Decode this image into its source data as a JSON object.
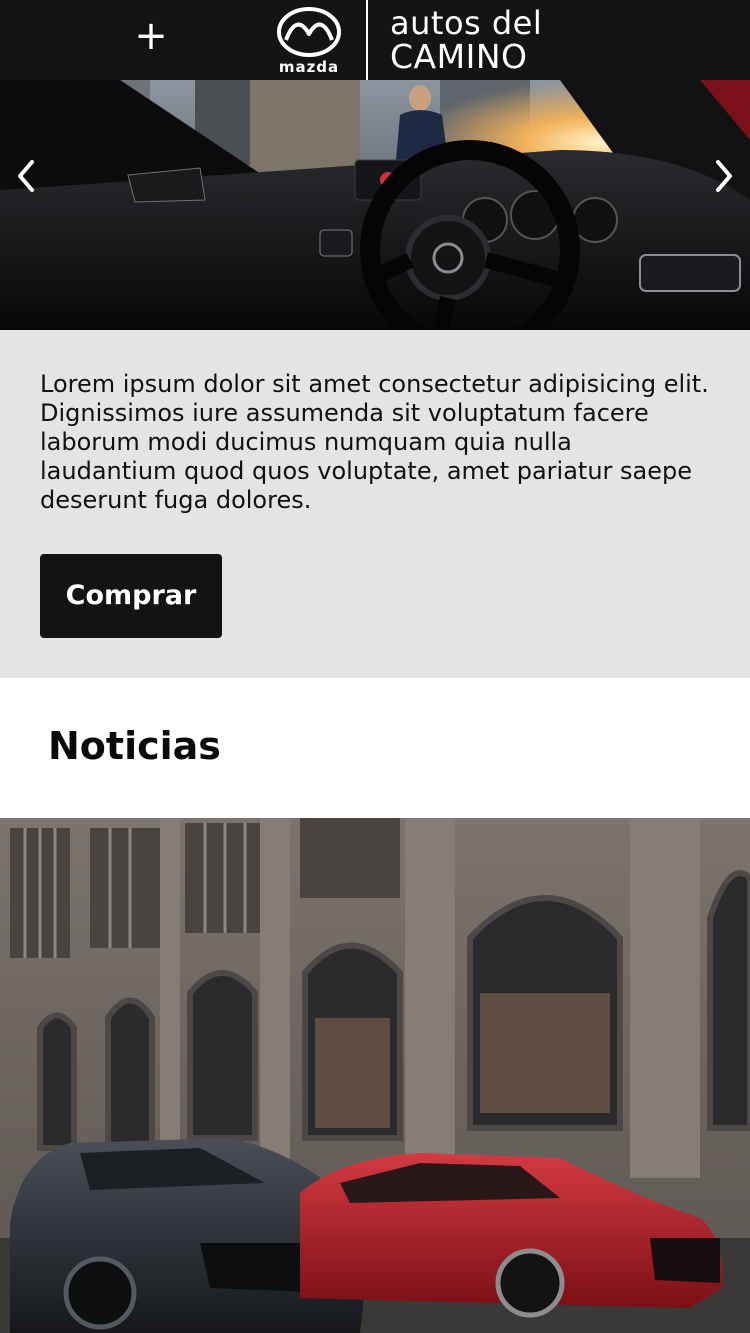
{
  "header": {
    "menu_icon": "plus-icon",
    "mazda_wordmark": "mazda",
    "brand_line1": "autos del",
    "brand_line2": "CAMINO"
  },
  "hero": {
    "image": "car-interior-photo",
    "prev_icon": "chevron-left-icon",
    "next_icon": "chevron-right-icon"
  },
  "promo": {
    "text": "Lorem ipsum dolor sit amet consectetur adipisicing elit. Dignissimos iure assumenda sit voluptatum facere laborum modi ducimus numquam quia nulla laudantium quod quos voluptate, amet pariatur saepe deserunt fuga dolores.",
    "buy_label": "Comprar"
  },
  "news": {
    "title": "Noticias",
    "image": "mazda-cars-building-photo"
  },
  "colors": {
    "header_bg": "#141414",
    "panel_bg": "#e4e4e4",
    "button_bg": "#131313",
    "accent_red": "#b01c24"
  }
}
